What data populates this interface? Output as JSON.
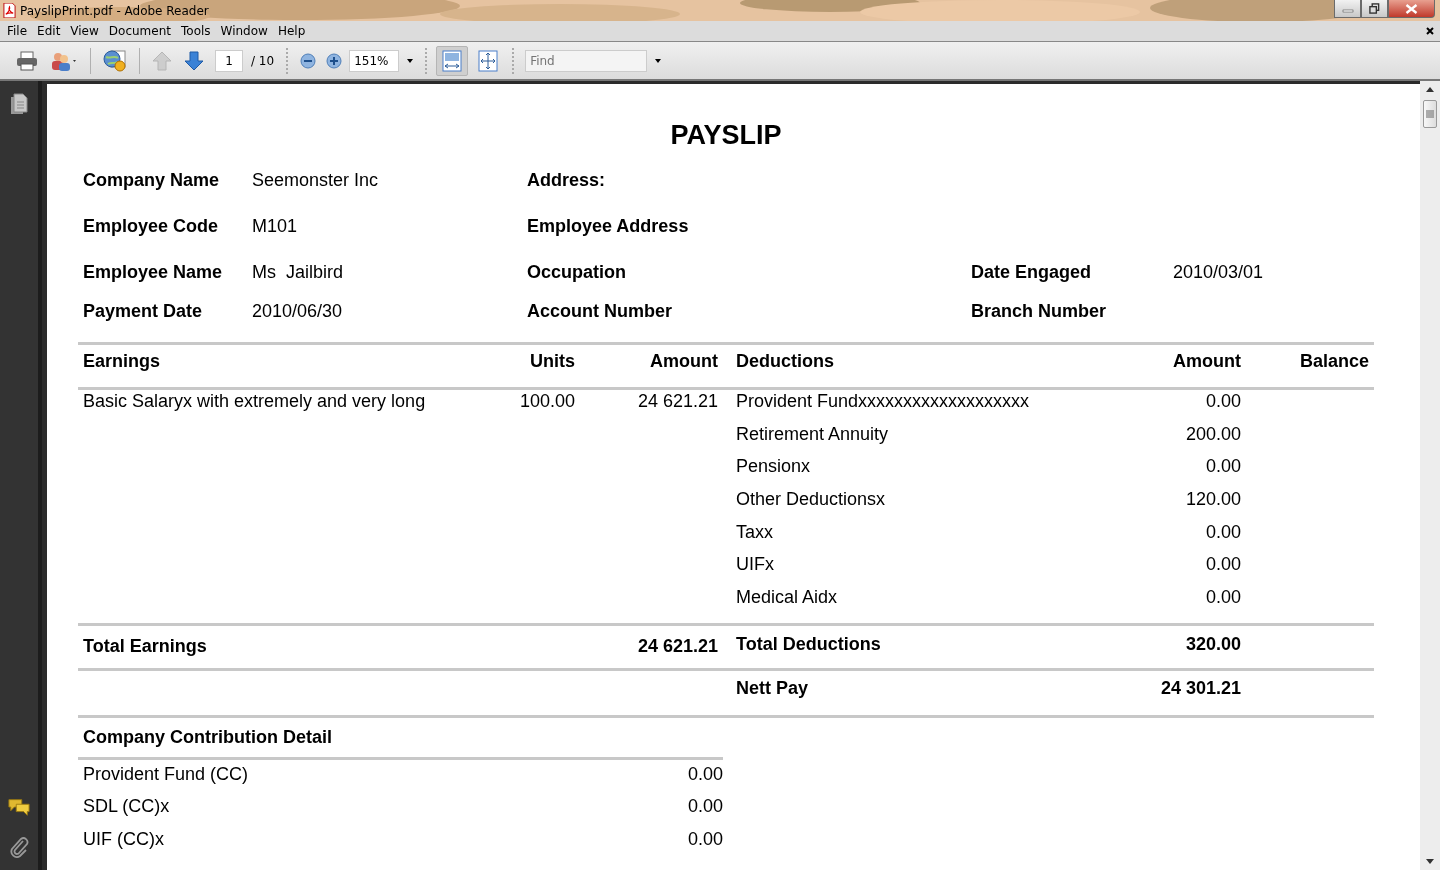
{
  "window": {
    "title": "PayslipPrint.pdf - Adobe Reader"
  },
  "menu": [
    "File",
    "Edit",
    "View",
    "Document",
    "Tools",
    "Window",
    "Help"
  ],
  "toolbar": {
    "nav": [
      {
        "kind": "previous",
        "disabled": true
      },
      {
        "kind": "next",
        "disabled": false
      }
    ],
    "page": "1",
    "page_total": "/ 10",
    "zoom": "151%",
    "views": [
      {
        "kind": "fit_width",
        "selected": true
      },
      {
        "kind": "fit_page",
        "selected": false
      }
    ],
    "find": {
      "placeholder": "Find"
    }
  },
  "document": {
    "title": "PAYSLIP",
    "info_rows": [
      [
        {
          "label": "Company Name",
          "value": "Seemonster Inc"
        },
        {
          "label": "Address:"
        }
      ],
      [
        {
          "label": "Employee Code",
          "value": "M101"
        },
        {
          "label": "Employee Address"
        }
      ],
      [
        {
          "label": "Employee Name",
          "value": "Ms  Jailbird"
        },
        {
          "label": "Occupation"
        },
        {
          "label": "Date Engaged",
          "value": "2010/03/01"
        }
      ],
      [
        {
          "label": "Payment Date",
          "value": "2010/06/30"
        },
        {
          "label": "Account Number"
        },
        {
          "label": "Branch Number"
        }
      ]
    ],
    "columns": [
      "Earnings",
      "Units",
      "Amount",
      "Deductions",
      "Amount",
      "Balance"
    ],
    "earnings": [
      {
        "description": "Basic Salaryx with extremely and very long",
        "units": "100.00",
        "amount": "24 621.21"
      }
    ],
    "deductions": [
      {
        "name": "Provident Fundxxxxxxxxxxxxxxxxxxx",
        "amount": "0.00"
      },
      {
        "name": "Retirement Annuity",
        "amount": "200.00"
      },
      {
        "name": "Pensionx",
        "amount": "0.00"
      },
      {
        "name": "Other Deductionsx",
        "amount": "120.00"
      },
      {
        "name": "Taxx",
        "amount": "0.00"
      },
      {
        "name": "UIFx",
        "amount": "0.00"
      },
      {
        "name": "Medical Aidx",
        "amount": "0.00"
      }
    ],
    "total_earnings": {
      "label": "Total Earnings",
      "amount": "24 621.21"
    },
    "total_deductions": {
      "label": "Total Deductions",
      "amount": "320.00"
    },
    "nett_pay": {
      "label": "Nett Pay",
      "amount": "24 301.21"
    },
    "contribution": {
      "title": "Company Contribution Detail",
      "rows": [
        {
          "name": "Provident Fund (CC)",
          "amount": "0.00"
        },
        {
          "name": "SDL (CC)x",
          "amount": "0.00"
        },
        {
          "name": "UIF (CC)x",
          "amount": "0.00"
        }
      ]
    }
  }
}
